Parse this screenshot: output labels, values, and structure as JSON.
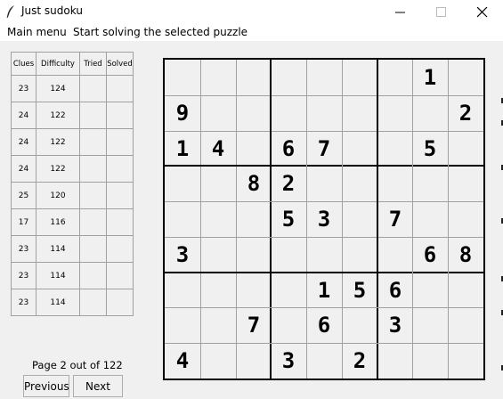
{
  "window": {
    "title": "Just sudoku"
  },
  "menu": {
    "items": [
      "Main menu",
      "Start solving the selected puzzle"
    ]
  },
  "puzzle_list": {
    "headers": [
      "Clues",
      "Difficulty",
      "Tried",
      "Solved"
    ],
    "rows": [
      [
        "23",
        "124",
        "",
        ""
      ],
      [
        "24",
        "122",
        "",
        ""
      ],
      [
        "24",
        "122",
        "",
        ""
      ],
      [
        "24",
        "122",
        "",
        ""
      ],
      [
        "25",
        "120",
        "",
        ""
      ],
      [
        "17",
        "116",
        "",
        ""
      ],
      [
        "23",
        "114",
        "",
        ""
      ],
      [
        "23",
        "114",
        "",
        ""
      ],
      [
        "23",
        "114",
        "",
        ""
      ]
    ]
  },
  "pagination": {
    "info": "Page 2 out of 122",
    "previous_label": "Previous",
    "next_label": "Next"
  },
  "board": {
    "grid": [
      [
        "",
        "",
        "",
        "",
        "",
        "",
        "",
        "1",
        ""
      ],
      [
        "9",
        "",
        "",
        "",
        "",
        "",
        "",
        "",
        "2"
      ],
      [
        "1",
        "4",
        "",
        "6",
        "7",
        "",
        "",
        "5",
        ""
      ],
      [
        "",
        "",
        "8",
        "2",
        "",
        "",
        "",
        "",
        ""
      ],
      [
        "",
        "",
        "",
        "5",
        "3",
        "",
        "7",
        "",
        ""
      ],
      [
        "3",
        "",
        "",
        "",
        "",
        "",
        "",
        "6",
        "8"
      ],
      [
        "",
        "",
        "",
        "",
        "1",
        "5",
        "6",
        "",
        ""
      ],
      [
        "",
        "",
        "7",
        "",
        "6",
        "",
        "3",
        "",
        ""
      ],
      [
        "4",
        "",
        "",
        "3",
        "",
        "2",
        "",
        "",
        ""
      ]
    ]
  },
  "colors": {
    "background": "#f0f0f0",
    "grid_thin": "#a0a0a0",
    "grid_thick": "#000000"
  }
}
